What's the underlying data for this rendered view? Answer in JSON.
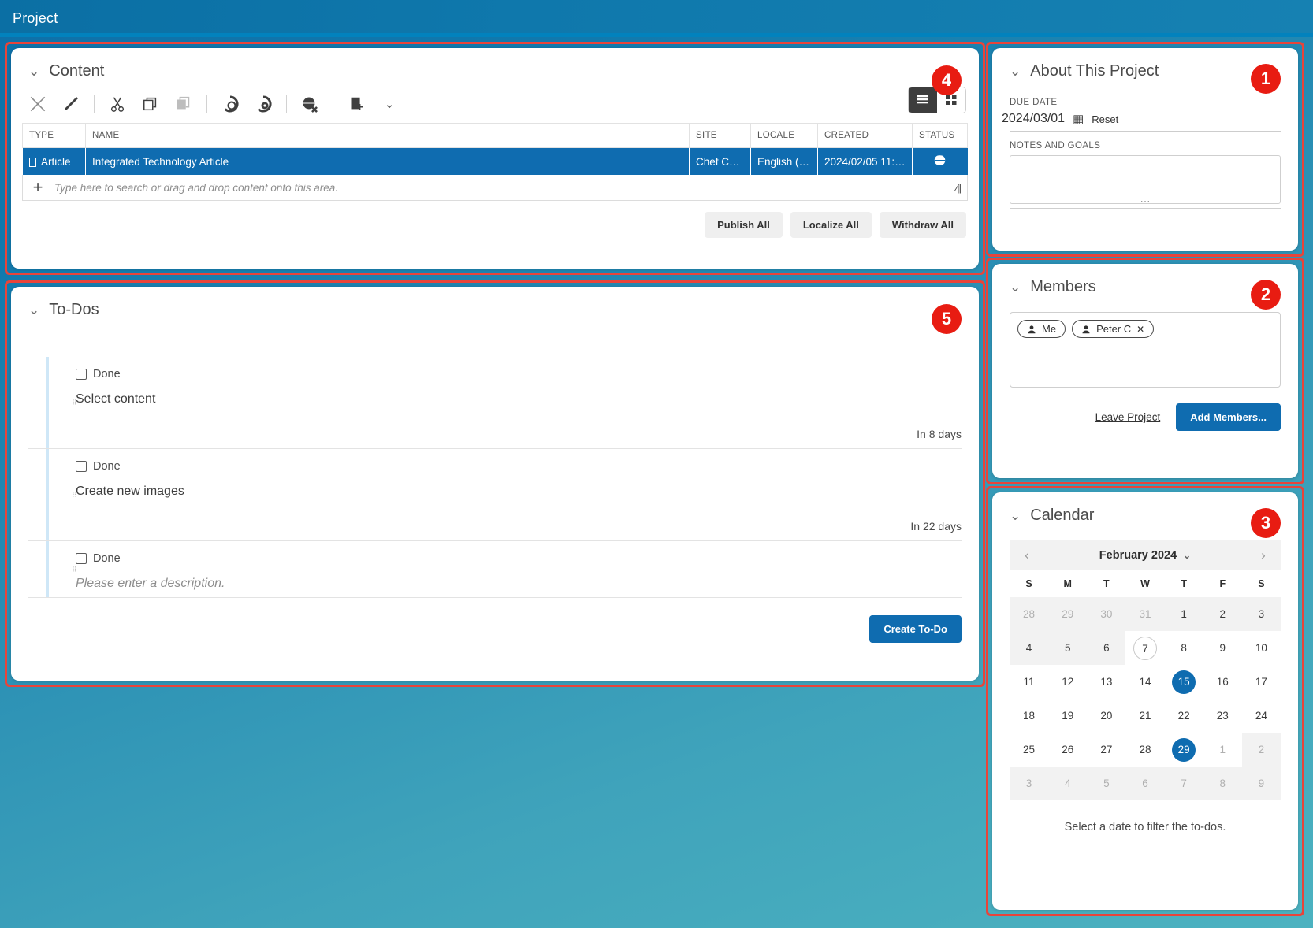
{
  "window": {
    "title": "Project"
  },
  "colors": {
    "accent": "#0f6cb0",
    "badge": "#e81c12",
    "selected_row": "#0f6cb0"
  },
  "content_panel": {
    "badge": "4",
    "title": "Content",
    "toolbar": [
      {
        "name": "delete-icon",
        "glyph": "✕"
      },
      {
        "name": "edit-icon",
        "glyph": "✏"
      },
      {
        "name": "cut-icon",
        "glyph": "✂"
      },
      {
        "name": "copy-icon",
        "glyph": "⧉"
      },
      {
        "name": "paste-icon",
        "glyph": "▣"
      },
      {
        "name": "publish-icon",
        "glyph": "◔"
      },
      {
        "name": "localize-icon",
        "glyph": "◕"
      },
      {
        "name": "withdraw-icon",
        "glyph": "◍"
      },
      {
        "name": "new-content-icon",
        "glyph": "▤"
      },
      {
        "name": "chevron-down-icon",
        "glyph": "⌄"
      }
    ],
    "view_list_label": "list-view",
    "view_grid_label": "grid-view",
    "columns": [
      "TYPE",
      "NAME",
      "SITE",
      "LOCALE",
      "CREATED",
      "STATUS"
    ],
    "rows": [
      {
        "type": "Article",
        "name": "Integrated Technology Article",
        "site": "Chef Corp.",
        "locale": "English (U…",
        "created": "2024/02/05 11:…",
        "status": "globe-icon"
      }
    ],
    "search_placeholder": "Type here to search or drag and drop content onto this area.",
    "buttons": {
      "publish_all": "Publish All",
      "localize_all": "Localize All",
      "withdraw_all": "Withdraw All"
    }
  },
  "todos_panel": {
    "badge": "5",
    "title": "To-Dos",
    "done_label": "Done",
    "items": [
      {
        "name": "Select content",
        "due": "In 8 days",
        "placeholder": false
      },
      {
        "name": "Create new images",
        "due": "In 22 days",
        "placeholder": false
      },
      {
        "name": "Please enter a description.",
        "due": "",
        "placeholder": true
      }
    ],
    "create_button": "Create To-Do"
  },
  "about_panel": {
    "badge": "1",
    "title": "About This Project",
    "due_date_label": "DUE DATE",
    "due_date_value": "2024/03/01",
    "reset_label": "Reset",
    "notes_label": "NOTES AND GOALS",
    "notes_value": ""
  },
  "members_panel": {
    "badge": "2",
    "title": "Members",
    "members": [
      {
        "name": "Me",
        "removable": false
      },
      {
        "name": "Peter C",
        "removable": true
      }
    ],
    "leave_label": "Leave Project",
    "add_label": "Add Members..."
  },
  "calendar_panel": {
    "badge": "3",
    "title": "Calendar",
    "month_label": "February 2024",
    "prev_label": "‹",
    "next_label": "›",
    "weekdays": [
      "S",
      "M",
      "T",
      "W",
      "T",
      "F",
      "S"
    ],
    "weeks": [
      [
        {
          "d": "28",
          "mute": true,
          "shade": true
        },
        {
          "d": "29",
          "mute": true,
          "shade": true
        },
        {
          "d": "30",
          "mute": true,
          "shade": true
        },
        {
          "d": "31",
          "mute": true,
          "shade": true
        },
        {
          "d": "1",
          "mute": false,
          "shade": true
        },
        {
          "d": "2",
          "mute": false,
          "shade": true
        },
        {
          "d": "3",
          "mute": false,
          "shade": true
        }
      ],
      [
        {
          "d": "4",
          "mute": false,
          "shade": true
        },
        {
          "d": "5",
          "mute": false,
          "shade": true
        },
        {
          "d": "6",
          "mute": false,
          "shade": true
        },
        {
          "d": "7",
          "mute": false,
          "shade": false,
          "today": true
        },
        {
          "d": "8",
          "mute": false,
          "shade": false
        },
        {
          "d": "9",
          "mute": false,
          "shade": false
        },
        {
          "d": "10",
          "mute": false,
          "shade": false
        }
      ],
      [
        {
          "d": "11",
          "mute": false,
          "shade": false
        },
        {
          "d": "12",
          "mute": false,
          "shade": false
        },
        {
          "d": "13",
          "mute": false,
          "shade": false
        },
        {
          "d": "14",
          "mute": false,
          "shade": false
        },
        {
          "d": "15",
          "mute": false,
          "shade": false,
          "marked": true
        },
        {
          "d": "16",
          "mute": false,
          "shade": false
        },
        {
          "d": "17",
          "mute": false,
          "shade": false
        }
      ],
      [
        {
          "d": "18",
          "mute": false,
          "shade": false
        },
        {
          "d": "19",
          "mute": false,
          "shade": false
        },
        {
          "d": "20",
          "mute": false,
          "shade": false
        },
        {
          "d": "21",
          "mute": false,
          "shade": false
        },
        {
          "d": "22",
          "mute": false,
          "shade": false
        },
        {
          "d": "23",
          "mute": false,
          "shade": false
        },
        {
          "d": "24",
          "mute": false,
          "shade": false
        }
      ],
      [
        {
          "d": "25",
          "mute": false,
          "shade": false
        },
        {
          "d": "26",
          "mute": false,
          "shade": false
        },
        {
          "d": "27",
          "mute": false,
          "shade": false
        },
        {
          "d": "28",
          "mute": false,
          "shade": false
        },
        {
          "d": "29",
          "mute": false,
          "shade": false,
          "marked": true
        },
        {
          "d": "1",
          "mute": true,
          "shade": false
        },
        {
          "d": "2",
          "mute": true,
          "shade": true
        }
      ],
      [
        {
          "d": "3",
          "mute": true,
          "shade": true
        },
        {
          "d": "4",
          "mute": true,
          "shade": true
        },
        {
          "d": "5",
          "mute": true,
          "shade": true
        },
        {
          "d": "6",
          "mute": true,
          "shade": true
        },
        {
          "d": "7",
          "mute": true,
          "shade": true
        },
        {
          "d": "8",
          "mute": true,
          "shade": true
        },
        {
          "d": "9",
          "mute": true,
          "shade": true
        }
      ]
    ],
    "hint": "Select a date to filter the to-dos."
  }
}
